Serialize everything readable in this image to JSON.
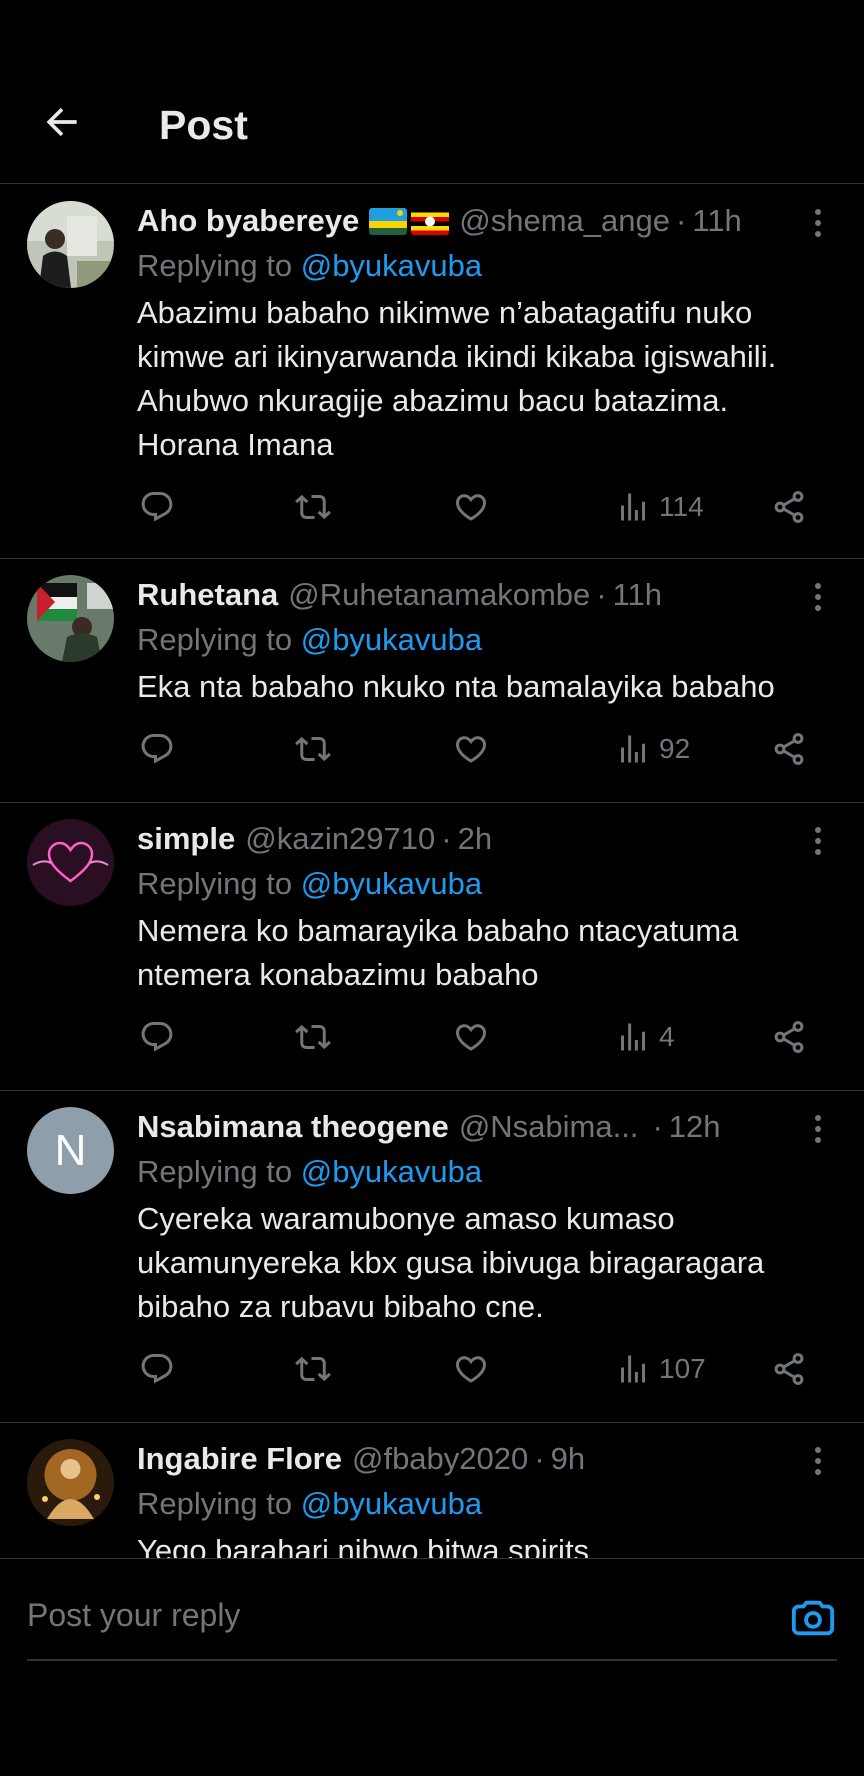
{
  "header": {
    "title": "Post"
  },
  "replies": [
    {
      "name": "Aho byabereye",
      "flags": [
        "rwanda-flag",
        "uganda-flag"
      ],
      "handle": "@shema_ange",
      "time": "11h",
      "replying_prefix": "Replying to",
      "replying_to": "@byukavuba",
      "text": "Abazimu babaho nikimwe n’abatagatifu nuko kimwe ari ikinyarwanda ikindi kikaba igiswahili. Ahubwo nkuragije abazimu bacu batazima. Horana Imana",
      "views": "114"
    },
    {
      "name": "Ruhetana",
      "handle": "@Ruhetanamakombe",
      "time": "11h",
      "replying_prefix": "Replying to",
      "replying_to": "@byukavuba",
      "text": "Eka nta babaho nkuko nta bamalayika babaho",
      "views": "92"
    },
    {
      "name": "simple",
      "handle": "@kazin29710",
      "time": "2h",
      "replying_prefix": "Replying to",
      "replying_to": "@byukavuba",
      "text": "Nemera ko bamarayika babaho ntacyatuma ntemera konabazimu babaho",
      "views": "4"
    },
    {
      "name": "Nsabimana theogene",
      "avatar_letter": "N",
      "handle": "@Nsabima...",
      "time": "12h",
      "replying_prefix": "Replying to",
      "replying_to": "@byukavuba",
      "text": "Cyereka waramubonye amaso kumaso ukamunyereka kbx gusa ibivuga biragaragara bibaho za rubavu bibaho cne.",
      "views": "107"
    },
    {
      "name": "Ingabire Flore",
      "handle": "@fbaby2020",
      "time": "9h",
      "replying_prefix": "Replying to",
      "replying_to": "@byukavuba",
      "text": "Yego barahari nibwo bitwa spirits"
    }
  ],
  "reply_bar": {
    "placeholder": "Post your reply"
  },
  "colors": {
    "accent": "#1d9bf0",
    "muted": "#71767b",
    "background": "#000000",
    "divider": "#2f3336"
  }
}
